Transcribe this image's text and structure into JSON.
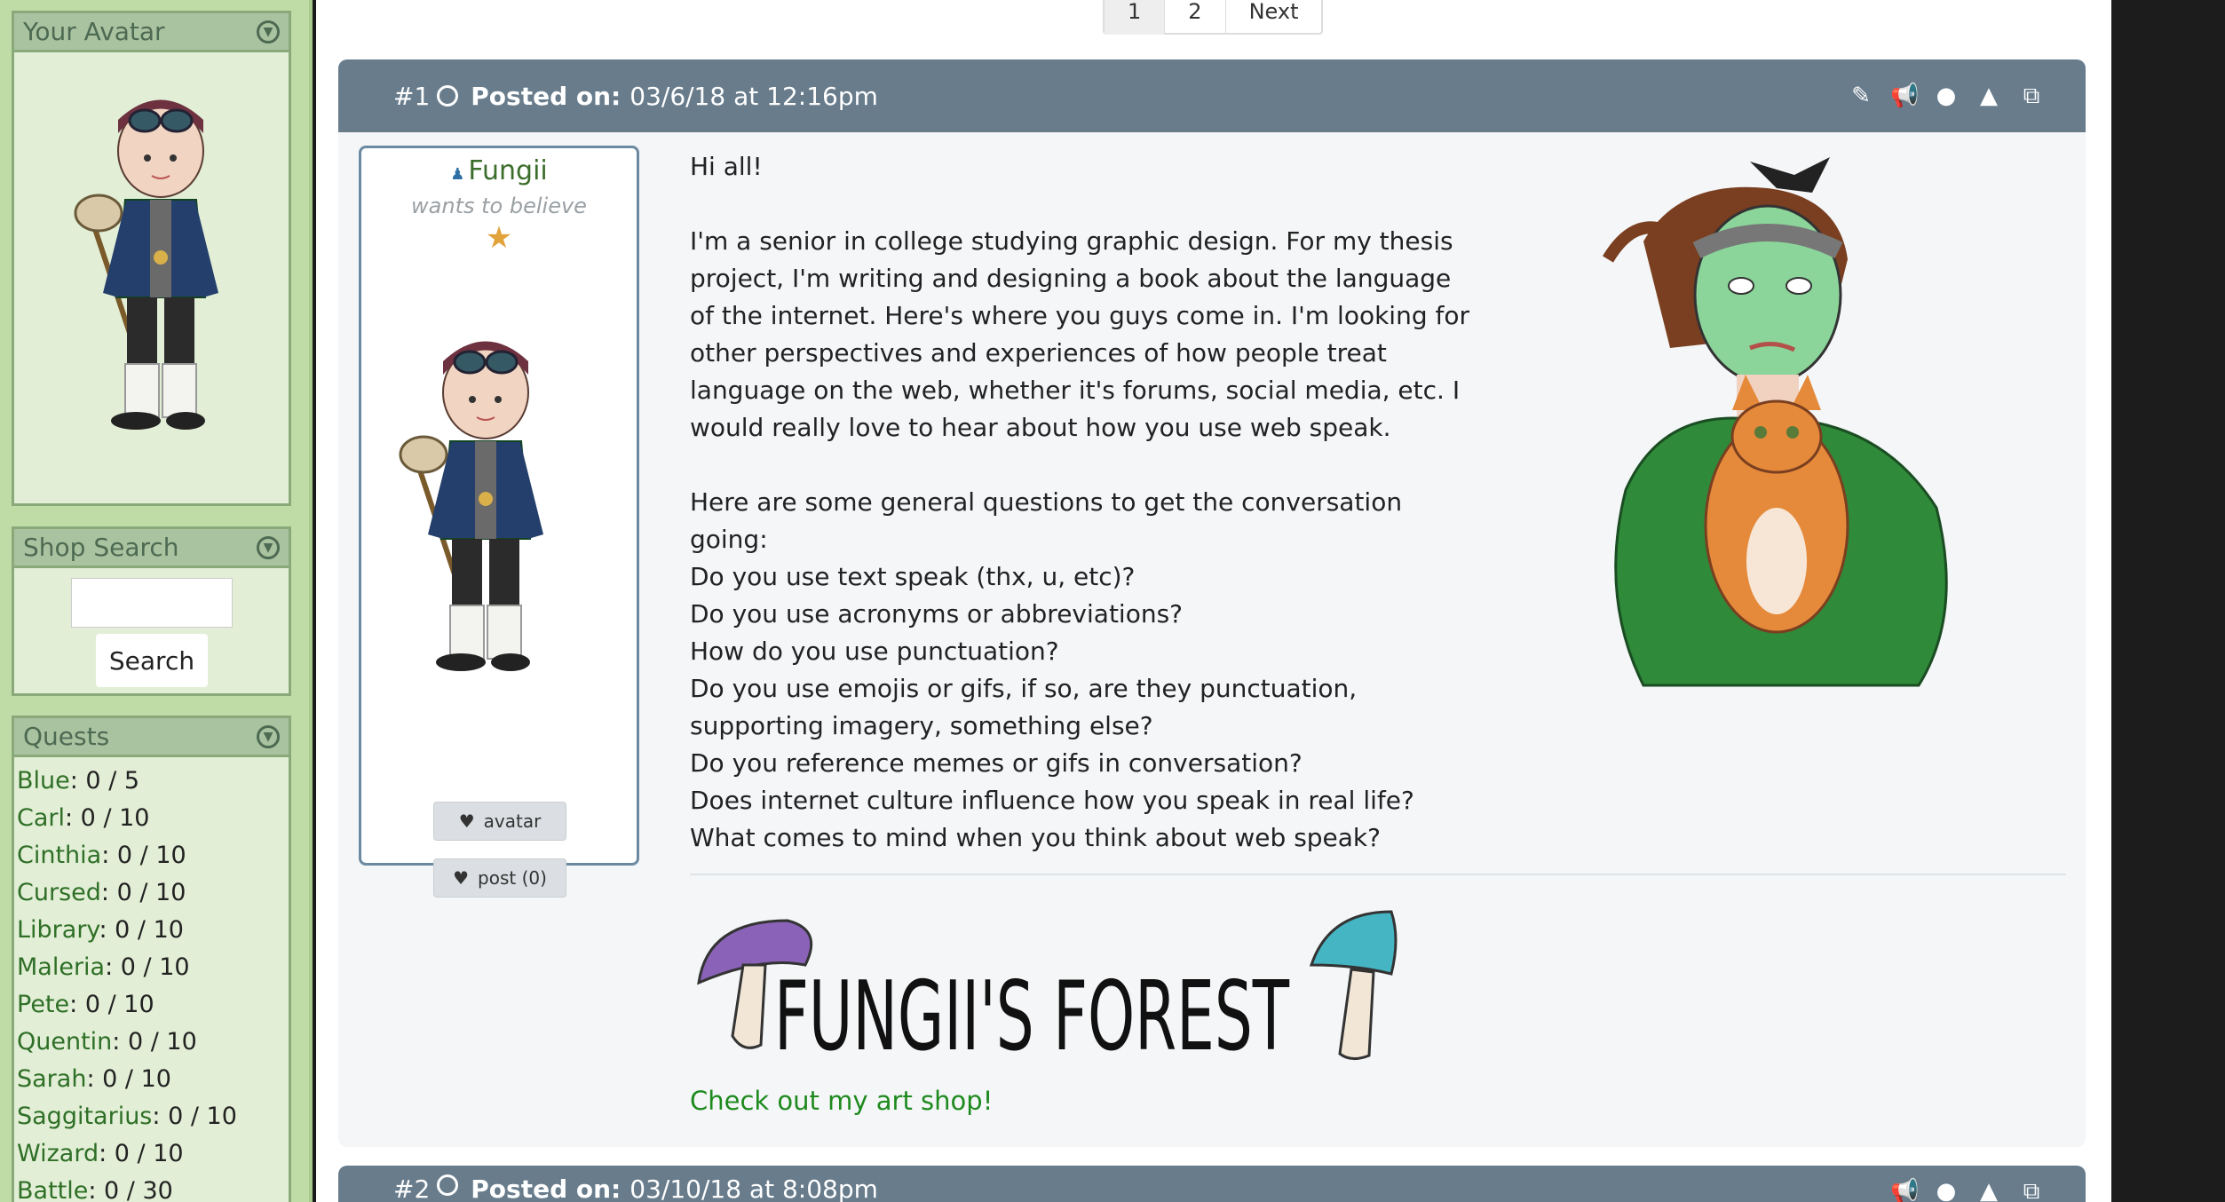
{
  "sidebar": {
    "avatar_widget": {
      "title": "Your Avatar"
    },
    "shop_widget": {
      "title": "Shop Search",
      "search_button": "Search",
      "search_value": ""
    },
    "quests_widget": {
      "title": "Quests",
      "items": [
        {
          "name": "Blue",
          "progress": ": 0 / 5"
        },
        {
          "name": "Carl",
          "progress": ": 0 / 10"
        },
        {
          "name": "Cinthia",
          "progress": ": 0 / 10"
        },
        {
          "name": "Cursed",
          "progress": ": 0 / 10"
        },
        {
          "name": "Library",
          "progress": ": 0 / 10"
        },
        {
          "name": "Maleria",
          "progress": ": 0 / 10"
        },
        {
          "name": "Pete",
          "progress": ": 0 / 10"
        },
        {
          "name": "Quentin",
          "progress": ": 0 / 10"
        },
        {
          "name": "Sarah",
          "progress": ": 0 / 10"
        },
        {
          "name": "Saggitarius",
          "progress": ": 0 / 10"
        },
        {
          "name": "Wizard",
          "progress": ": 0 / 10"
        },
        {
          "name": "Battle",
          "progress": ": 0 / 30"
        }
      ]
    }
  },
  "pagination": {
    "pages": [
      "1",
      "2"
    ],
    "next": "Next",
    "current": "1"
  },
  "post1": {
    "number": "#1",
    "posted_label": "Posted on:",
    "posted_date": "03/6/18 at 12:16pm",
    "author": {
      "name": "Fungii",
      "tagline": "wants to believe",
      "avatar_button": "avatar",
      "post_button": "post (0)"
    },
    "body": {
      "greeting": "Hi all!",
      "intro": "I'm a senior in college studying graphic design. For my thesis project, I'm writing and designing a book about the language of the internet. Here's where you guys come in. I'm looking for other perspectives and experiences of how people treat language on the web, whether it's forums, social media, etc. I would really love to hear about how you use web speak.",
      "questions_intro": "Here are some general questions to get the conversation going:",
      "questions": [
        "Do you use text speak (thx, u, etc)?",
        "Do you use acronyms or abbreviations?",
        "How do you use punctuation?",
        "Do you use emojis or gifs, if so, are they punctuation, supporting imagery, something else?",
        "Do you reference memes or gifs in conversation?",
        "Does internet culture influence how you speak in real life?",
        "What comes to mind when you think about web speak?"
      ]
    },
    "signature": {
      "banner_text": "FUNGII'S FOREST",
      "shop_link": "Check out my art shop!"
    }
  },
  "post2": {
    "number": "#2",
    "posted_label": "Posted on:",
    "posted_date": "03/10/18 at 8:08pm"
  },
  "icons": {
    "post_actions": [
      "edit-icon",
      "megaphone-icon",
      "comment-icon",
      "warning-icon",
      "external-link-icon"
    ]
  },
  "colors": {
    "sidebar_bg": "#c0dca6",
    "post_header": "#687c8c",
    "link_green": "#1e8a1e",
    "star": "#e3a33c"
  }
}
